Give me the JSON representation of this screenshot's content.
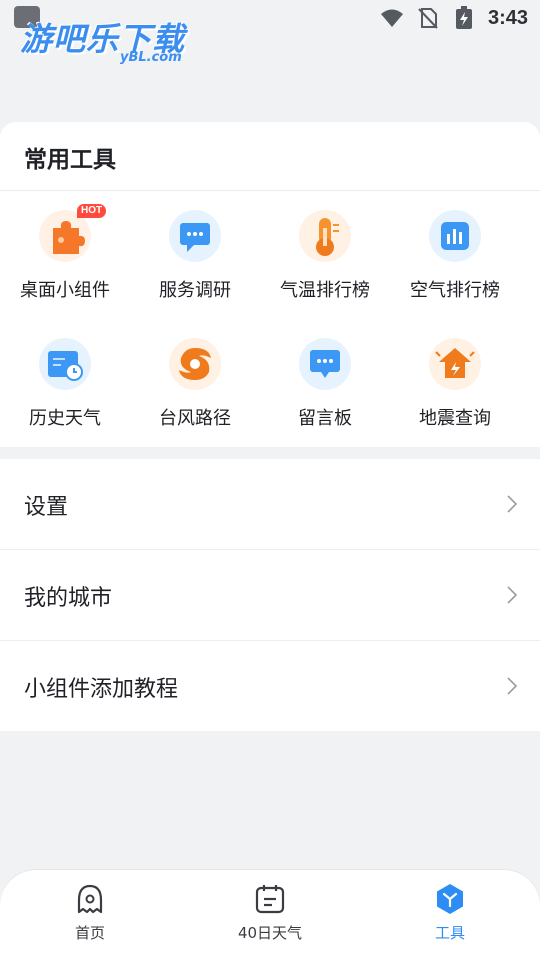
{
  "status_bar": {
    "time": "3:43",
    "icons": [
      "wifi-icon",
      "no-sim-icon",
      "battery-charging-icon"
    ]
  },
  "watermark": {
    "main": "游吧乐下载",
    "sub": "yBL.com"
  },
  "tools_card": {
    "title": "常用工具",
    "tools": [
      {
        "label": "桌面小组件",
        "icon": "puzzle-icon",
        "badge": "HOT"
      },
      {
        "label": "服务调研",
        "icon": "survey-chat-icon"
      },
      {
        "label": "气温排行榜",
        "icon": "thermometer-icon"
      },
      {
        "label": "空气排行榜",
        "icon": "bar-chart-icon"
      },
      {
        "label": "历史天气",
        "icon": "calendar-clock-icon"
      },
      {
        "label": "台风路径",
        "icon": "typhoon-icon"
      },
      {
        "label": "留言板",
        "icon": "message-board-icon"
      },
      {
        "label": "地震查询",
        "icon": "earthquake-house-icon"
      }
    ]
  },
  "settings": [
    {
      "label": "设置"
    },
    {
      "label": "我的城市"
    },
    {
      "label": "小组件添加教程"
    }
  ],
  "bottom_nav": [
    {
      "label": "首页",
      "icon": "home-ghost-icon",
      "active": false
    },
    {
      "label": "40日天气",
      "icon": "calendar-icon",
      "active": false
    },
    {
      "label": "工具",
      "icon": "tools-hex-icon",
      "active": true
    }
  ],
  "colors": {
    "accent": "#2e8df5",
    "background": "#f1f2f4",
    "hot_badge": "#ff4a3d"
  }
}
